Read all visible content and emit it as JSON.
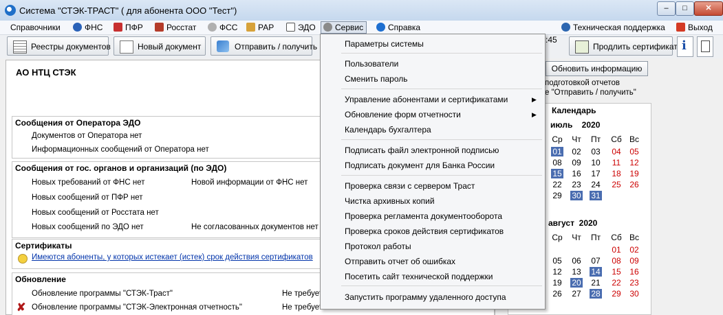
{
  "window": {
    "title": "Система \"СТЭК-ТРАСТ\" ( для абонента ООО \"Тест\")",
    "minimize": "–",
    "maximize": "□",
    "close": "✕"
  },
  "menubar": {
    "items": [
      "Справочники",
      "ФНС",
      "ПФР",
      "Росстат",
      "ФСС",
      "РАР",
      "ЭДО",
      "Сервис",
      "Справка"
    ],
    "support": "Техническая поддержка",
    "exit": "Выход"
  },
  "toolbar": {
    "registries": "Реестры документов",
    "new_doc": "Новый документ",
    "send_receive": "Отправить / получить",
    "time": ":45",
    "renew_cert": "Продлить сертификат"
  },
  "main": {
    "org": "АО НТЦ СТЭК",
    "operator_title": "Сообщения от Оператора ЭДО",
    "operator_docs": "Документов от Оператора нет",
    "operator_info": "Информационных сообщений от Оператора нет",
    "gov_title": "Сообщения от гос. органов и организаций (по ЭДО)",
    "fns_req": "Новых требований от ФНС нет",
    "fns_info": "Новой информации от ФНС нет",
    "pfr": "Новых сообщений от ПФР нет",
    "rosstat": "Новых сообщений от Росстата нет",
    "edo": "Новых сообщений по ЭДО нет",
    "not_agreed": "Не согласованных документов нет",
    "certs_title": "Сертификаты",
    "certs_link": "Имеются абоненты, у которых истекает (истек) срок действия сертификатов",
    "update_title": "Обновление",
    "update_trast": "Обновление программы \"СТЭК-Траст\"",
    "update_trast_status": "Не требует",
    "update_eo": "Обновление программы \"СТЭК-Электронная отчетность\"",
    "update_eo_status": "Не требует"
  },
  "right": {
    "update_info": "Обновить информацию",
    "note1": "подготовкой отчетов",
    "note2": "е \"Отправить / получить\"",
    "calendar_title": "Календарь",
    "july": {
      "month": "июль",
      "year": "2020"
    },
    "august": {
      "month": "август",
      "year": "2020"
    },
    "weekdays": [
      "Ср",
      "Чт",
      "Пт",
      "Сб",
      "Вс"
    ]
  },
  "dropdown": {
    "items": [
      "Параметры системы",
      "Пользователи",
      "Сменить пароль",
      "Управление абонентами и сертификатами",
      "Обновление форм отчетности",
      "Календарь бухгалтера",
      "Подписать файл электронной подписью",
      "Подписать документ для Банка России",
      "Проверка связи с сервером Траст",
      "Чистка архивных копий",
      "Проверка регламента документооборота",
      "Проверка сроков действия сертификатов",
      "Протокол работы",
      "Отправить отчет об ошибках",
      "Посетить сайт технической поддержки",
      "Запустить программу удаленного доступа"
    ],
    "arrow": "▶"
  },
  "colors": {
    "accent": "#4a6db0",
    "weekend": "#cc0000",
    "link": "#0033aa"
  }
}
